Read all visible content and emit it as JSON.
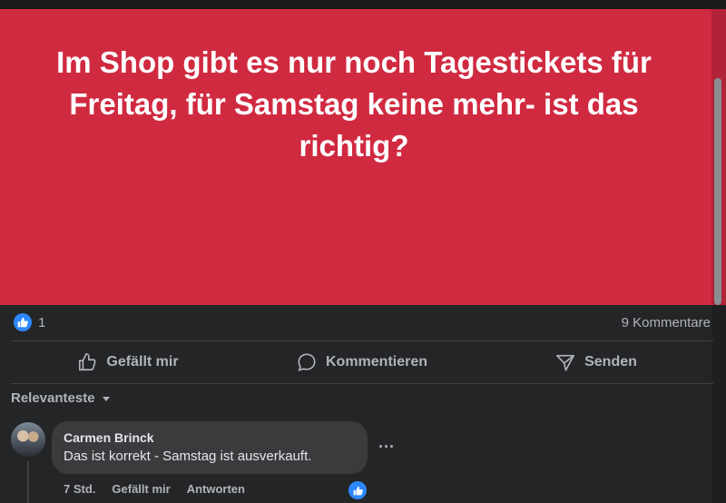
{
  "post": {
    "text": "Im Shop gibt es nur noch Tagestickets für Freitag, für Samstag keine mehr- ist das richtig?",
    "background_color": "#d02a41"
  },
  "stats": {
    "like_count": "1",
    "comments": "9 Kommentare"
  },
  "actions": {
    "like": "Gefällt mir",
    "comment": "Kommentieren",
    "share": "Senden"
  },
  "sort": {
    "label": "Relevanteste"
  },
  "comment": {
    "author": "Carmen Brinck",
    "text": "Das ist korrekt - Samstag ist ausverkauft.",
    "time": "7 Std.",
    "like_label": "Gefällt mir",
    "reply_label": "Antworten"
  },
  "icons": {
    "like_reaction": "thumbs-up-icon",
    "like_action": "thumbs-up-outline-icon",
    "comment_action": "speech-bubble-icon",
    "share_action": "send-icon",
    "sort": "caret-down-icon",
    "more": "more-horizontal-icon"
  }
}
